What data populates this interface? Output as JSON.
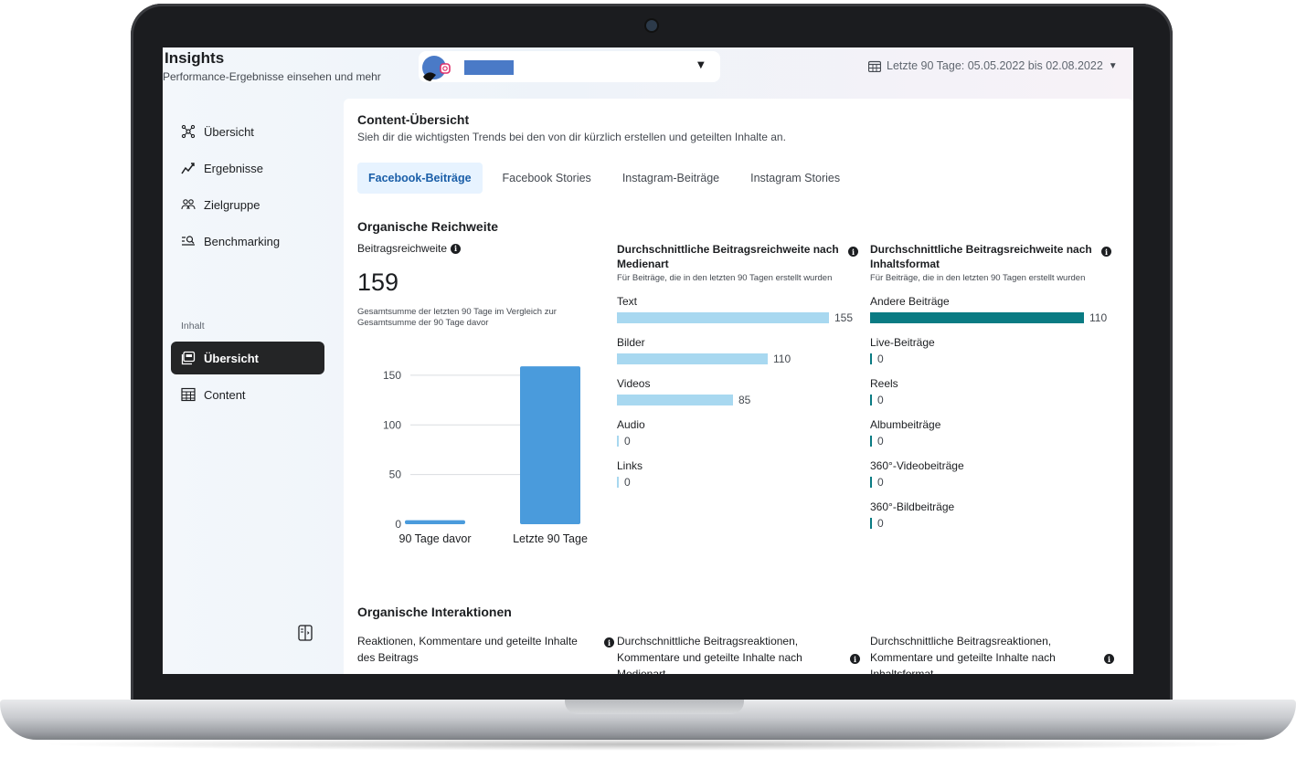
{
  "app": {
    "title": "Insights",
    "subtitle": "Performance-Ergebnisse einsehen und mehr"
  },
  "header": {
    "date_range": "Letzte 90 Tage: 05.05.2022 bis 02.08.2022"
  },
  "sidebar": {
    "items": [
      {
        "label": "Übersicht",
        "icon": "network-icon"
      },
      {
        "label": "Ergebnisse",
        "icon": "trend-icon"
      },
      {
        "label": "Zielgruppe",
        "icon": "people-icon"
      },
      {
        "label": "Benchmarking",
        "icon": "benchmark-icon"
      }
    ],
    "section_label": "Inhalt",
    "content_items": [
      {
        "label": "Übersicht",
        "icon": "content-overview-icon",
        "active": true
      },
      {
        "label": "Content",
        "icon": "table-icon"
      }
    ]
  },
  "main": {
    "title": "Content-Übersicht",
    "subtitle": "Sieh dir die wichtigsten Trends bei den von dir kürzlich erstellen und geteilten Inhalte an.",
    "tabs": [
      {
        "label": "Facebook-Beiträge",
        "active": true
      },
      {
        "label": "Facebook Stories",
        "active": false
      },
      {
        "label": "Instagram-Beiträge",
        "active": false
      },
      {
        "label": "Instagram Stories",
        "active": false
      }
    ],
    "organic_reach": {
      "title": "Organische Reichweite",
      "metric_label": "Beitragsreichweite",
      "metric_value": "159",
      "metric_note": "Gesamtsumme der letzten 90 Tage im Vergleich zur Gesamtsumme der 90 Tage davor"
    },
    "media_type": {
      "title": "Durchschnittliche Beitragsreichweite nach Medienart",
      "note": "Für Beiträge, die in den letzten 90 Tagen erstellt wurden",
      "max": 155,
      "color": "#a8d8f0",
      "rows": [
        {
          "label": "Text",
          "value": 155
        },
        {
          "label": "Bilder",
          "value": 110
        },
        {
          "label": "Videos",
          "value": 85
        },
        {
          "label": "Audio",
          "value": 0
        },
        {
          "label": "Links",
          "value": 0
        }
      ]
    },
    "content_format": {
      "title": "Durchschnittliche Beitragsreichweite nach Inhaltsformat",
      "note": "Für Beiträge, die in den letzten 90 Tagen erstellt wurden",
      "max": 110,
      "color": "#0a7b83",
      "rows": [
        {
          "label": "Andere Beiträge",
          "value": 110
        },
        {
          "label": "Live-Beiträge",
          "value": 0
        },
        {
          "label": "Reels",
          "value": 0
        },
        {
          "label": "Albumbeiträge",
          "value": 0
        },
        {
          "label": "360°-Videobeiträge",
          "value": 0
        },
        {
          "label": "360°-Bildbeiträge",
          "value": 0
        }
      ]
    },
    "organic_interactions": {
      "title": "Organische Interaktionen",
      "col1": "Reaktionen, Kommentare und geteilte Inhalte des Beitrags",
      "col2": "Durchschnittliche Beitragsreaktionen, Kommentare und geteilte Inhalte nach Medienart",
      "col3": "Durchschnittliche Beitragsreaktionen, Kommentare und geteilte Inhalte nach Inhaltsformat"
    }
  },
  "chart_data": {
    "type": "bar",
    "categories": [
      "90 Tage davor",
      "Letzte 90 Tage"
    ],
    "values": [
      4,
      159
    ],
    "yticks": [
      0,
      50,
      100,
      150
    ],
    "ylim": [
      0,
      160
    ],
    "color": "#4a9bdc",
    "grid": true
  }
}
